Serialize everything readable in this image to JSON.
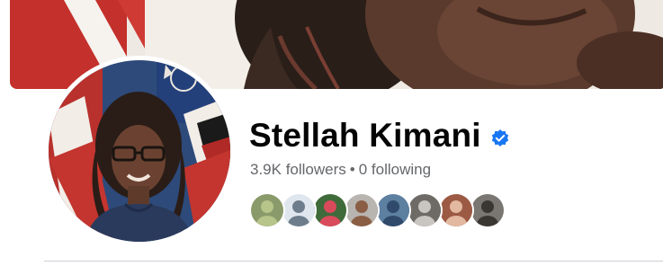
{
  "profile": {
    "name": "Stellah Kimani",
    "verified": true,
    "followers_text": "3.9K followers",
    "separator": "•",
    "following_text": "0 following"
  },
  "icons": {
    "verified": "verified-badge-icon"
  },
  "follower_avatars": [
    {
      "label": "follower-avatar-1",
      "bg": "#8a9a6a",
      "fg": "#b7c48a"
    },
    {
      "label": "follower-avatar-2",
      "bg": "#dfe6ee",
      "fg": "#6d7d8c"
    },
    {
      "label": "follower-avatar-3",
      "bg": "#3f6a3a",
      "fg": "#d94a5a"
    },
    {
      "label": "follower-avatar-4",
      "bg": "#b8b4b0",
      "fg": "#8a5e44"
    },
    {
      "label": "follower-avatar-5",
      "bg": "#5d7fa0",
      "fg": "#2f4a6b"
    },
    {
      "label": "follower-avatar-6",
      "bg": "#6e6a66",
      "fg": "#c9c5c0"
    },
    {
      "label": "follower-avatar-7",
      "bg": "#9c5a44",
      "fg": "#e2b9a0"
    },
    {
      "label": "follower-avatar-8",
      "bg": "#7a7672",
      "fg": "#3a3632"
    }
  ],
  "colors": {
    "accent": "#1877f2",
    "name": "#050505",
    "secondary_text": "#65676b",
    "divider": "#ced0d4"
  }
}
